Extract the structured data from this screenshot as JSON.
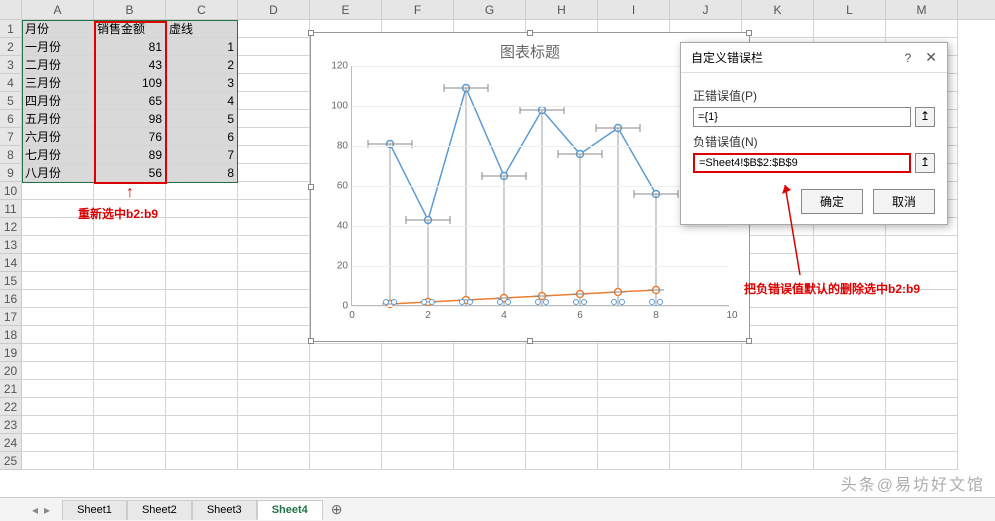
{
  "columns": [
    "A",
    "B",
    "C",
    "D",
    "E",
    "F",
    "G",
    "H",
    "I",
    "J",
    "K",
    "L",
    "M"
  ],
  "rows": 25,
  "headers": {
    "A": "月份",
    "B": "销售金额",
    "C": "虚线"
  },
  "data": [
    {
      "A": "一月份",
      "B": 81,
      "C": 1
    },
    {
      "A": "二月份",
      "B": 43,
      "C": 2
    },
    {
      "A": "三月份",
      "B": 109,
      "C": 3
    },
    {
      "A": "四月份",
      "B": 65,
      "C": 4
    },
    {
      "A": "五月份",
      "B": 98,
      "C": 5
    },
    {
      "A": "六月份",
      "B": 76,
      "C": 6
    },
    {
      "A": "七月份",
      "B": 89,
      "C": 7
    },
    {
      "A": "八月份",
      "B": 56,
      "C": 8
    }
  ],
  "annotation1": "重新选中b2:b9",
  "annotation2": "把负错误值默认的删除选中b2:b9",
  "chart_data": {
    "type": "line",
    "title": "图表标题",
    "x": [
      1,
      2,
      3,
      4,
      5,
      6,
      7,
      8
    ],
    "series": [
      {
        "name": "销售金额",
        "values": [
          81,
          43,
          109,
          65,
          98,
          76,
          89,
          56
        ],
        "color": "#5b9bd5"
      },
      {
        "name": "虚线",
        "values": [
          1,
          2,
          3,
          4,
          5,
          6,
          7,
          8
        ],
        "color": "#ed7d31"
      }
    ],
    "y_ticks": [
      0,
      20,
      40,
      60,
      80,
      100,
      120
    ],
    "x_ticks": [
      0,
      2,
      4,
      6,
      8,
      10
    ],
    "ylim": [
      0,
      120
    ],
    "xlim": [
      0,
      10
    ]
  },
  "dialog": {
    "title": "自定义错误栏",
    "pos_label": "正错误值(P)",
    "pos_value": "={1}",
    "neg_label": "负错误值(N)",
    "neg_value": "=Sheet4!$B$2:$B$9",
    "ok": "确定",
    "cancel": "取消"
  },
  "tabs": [
    "Sheet1",
    "Sheet2",
    "Sheet3",
    "Sheet4"
  ],
  "active_tab": "Sheet4",
  "watermark": "头条@易坊好文馆"
}
